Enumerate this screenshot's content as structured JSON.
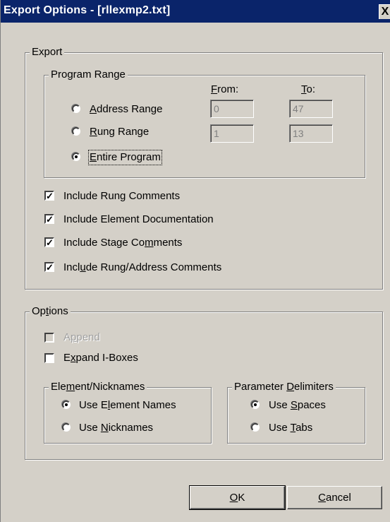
{
  "window": {
    "title": "Export Options - [rllexmp2.txt]",
    "close_label": "X"
  },
  "export_group": {
    "legend": "Export",
    "program_range": {
      "legend": "Program Range",
      "from_header": "From:",
      "to_header": "To:",
      "options": [
        {
          "label": "Address Range",
          "selected": false,
          "from": "0",
          "to": "47"
        },
        {
          "label": "Rung Range",
          "selected": false,
          "from": "1",
          "to": "13"
        },
        {
          "label": "Entire Program",
          "selected": true
        }
      ]
    },
    "checkboxes": [
      {
        "label": "Include Rung Comments",
        "checked": true
      },
      {
        "label": "Include Element Documentation",
        "checked": true
      },
      {
        "label": "Include Stage Comments",
        "checked": true
      },
      {
        "label": "Include Rung/Address Comments",
        "checked": true
      }
    ]
  },
  "options_group": {
    "legend": "Options",
    "append": {
      "label": "Append",
      "checked": false,
      "disabled": true
    },
    "expand": {
      "label": "Expand I-Boxes",
      "checked": false
    },
    "element_nicknames": {
      "legend": "Element/Nicknames",
      "options": [
        {
          "label": "Use Element Names",
          "selected": true
        },
        {
          "label": "Use Nicknames",
          "selected": false
        }
      ]
    },
    "parameter_delimiters": {
      "legend": "Parameter Delimiters",
      "options": [
        {
          "label": "Use Spaces",
          "selected": true
        },
        {
          "label": "Use Tabs",
          "selected": false
        }
      ]
    }
  },
  "buttons": {
    "ok": "OK",
    "cancel": "Cancel"
  }
}
